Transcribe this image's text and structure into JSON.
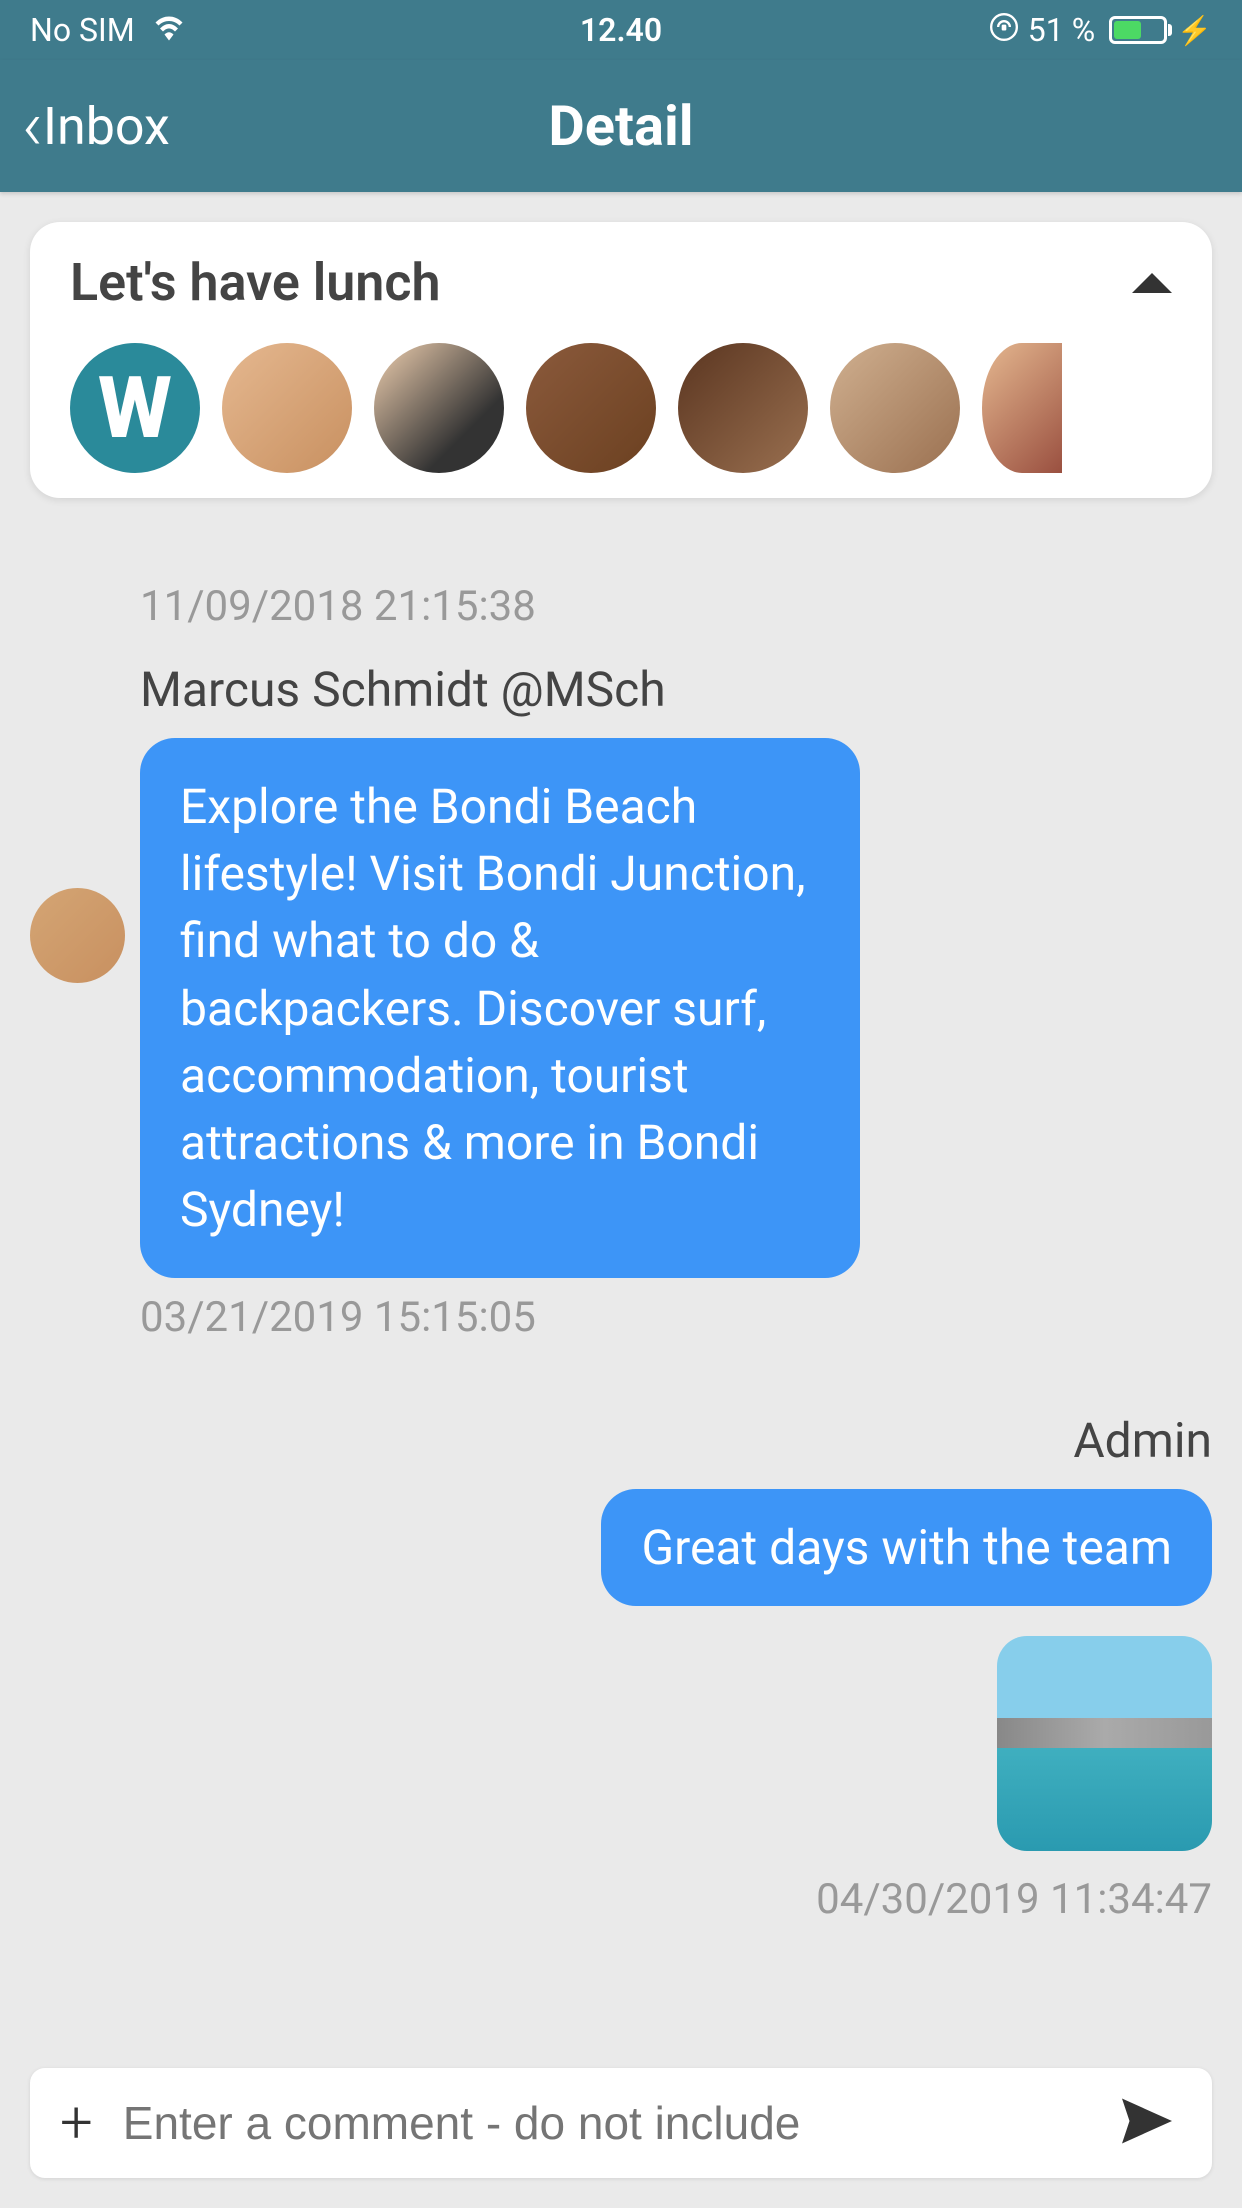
{
  "statusBar": {
    "carrier": "No SIM",
    "time": "12.40",
    "batteryPercent": "51 %"
  },
  "nav": {
    "backLabel": "Inbox",
    "title": "Detail"
  },
  "threadHeader": {
    "title": "Let's have lunch",
    "avatars": [
      "W",
      "person1",
      "person2",
      "person3",
      "person4",
      "person5",
      "person6"
    ]
  },
  "messages": [
    {
      "side": "timestamp-only",
      "timestamp": "11/09/2018 21:15:38"
    },
    {
      "side": "left",
      "sender": "Marcus Schmidt @MSch",
      "text": "Explore the Bondi Beach lifestyle! Visit Bondi Junction, find what to do & backpackers. Discover surf, accommodation, tourist attractions & more in Bondi Sydney!",
      "timestamp": "03/21/2019 15:15:05"
    },
    {
      "side": "right",
      "sender": "Admin",
      "text": "Great days with the team",
      "hasImage": true,
      "timestamp": "04/30/2019 11:34:47"
    }
  ],
  "composer": {
    "placeholder": "Enter a comment - do not include"
  }
}
